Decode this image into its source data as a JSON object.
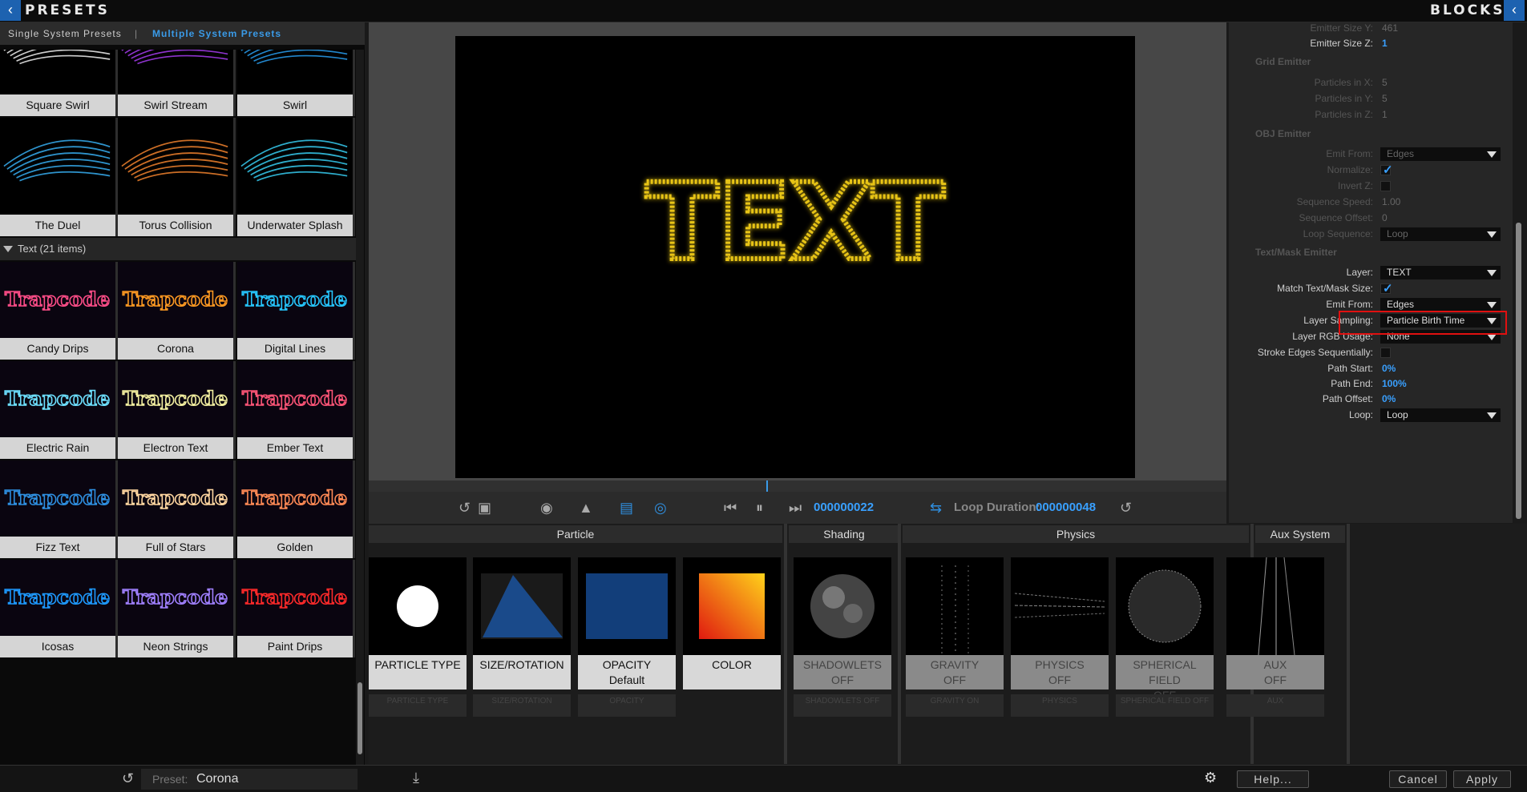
{
  "header": {
    "left_title": "PRESETS",
    "right_title": "BLOCKS",
    "left_btn": "‹",
    "right_btn": "‹"
  },
  "subtabs": {
    "single": "Single System Presets",
    "multiple": "Multiple System Presets",
    "sep": "|"
  },
  "presets_top_rows": [
    [
      "Square Swirl",
      "Swirl Stream",
      "Swirl"
    ],
    [
      "The Duel",
      "Torus Collision",
      "Underwater Splash"
    ]
  ],
  "text_section": {
    "label": "Text (21 items)"
  },
  "text_rows": [
    [
      "Candy Drips",
      "Corona",
      "Digital Lines"
    ],
    [
      "Electric Rain",
      "Electron Text",
      "Ember Text"
    ],
    [
      "Fizz Text",
      "Full of Stars",
      "Golden"
    ],
    [
      "Icosas",
      "Neon Strings",
      "Paint Drips"
    ]
  ],
  "thumb_word": "Trapcode",
  "canvas_text": "TEXT",
  "transport": {
    "frame": "000000022",
    "loop_label": "Loop Duration:",
    "loop_value": "000000048"
  },
  "blocks_panel": {
    "rows": [
      {
        "label": "Emitter Size Y:",
        "value": "461",
        "dim": true,
        "type": "text"
      },
      {
        "label": "Emitter Size Z:",
        "value": "1",
        "dim": false,
        "type": "blue"
      },
      {
        "section": "Grid Emitter"
      },
      {
        "label": "Particles in X:",
        "value": "5",
        "dim": true,
        "type": "text"
      },
      {
        "label": "Particles in Y:",
        "value": "5",
        "dim": true,
        "type": "text"
      },
      {
        "label": "Particles in Z:",
        "value": "1",
        "dim": true,
        "type": "text"
      },
      {
        "section": "OBJ Emitter"
      },
      {
        "label": "Emit From:",
        "value": "Edges",
        "dim": true,
        "type": "dd"
      },
      {
        "label": "Normalize:",
        "value": "",
        "dim": true,
        "type": "check_on"
      },
      {
        "label": "Invert Z:",
        "value": "",
        "dim": true,
        "type": "check_off"
      },
      {
        "label": "Sequence Speed:",
        "value": "1.00",
        "dim": true,
        "type": "text"
      },
      {
        "label": "Sequence Offset:",
        "value": "0",
        "dim": true,
        "type": "text"
      },
      {
        "label": "Loop Sequence:",
        "value": "Loop",
        "dim": true,
        "type": "dd"
      },
      {
        "section": "Text/Mask Emitter"
      },
      {
        "label": "Layer:",
        "value": "TEXT",
        "dim": false,
        "type": "dd"
      },
      {
        "label": "Match Text/Mask Size:",
        "value": "",
        "dim": false,
        "type": "check_on"
      },
      {
        "label": "Emit From:",
        "value": "Edges",
        "dim": false,
        "type": "dd"
      },
      {
        "label": "Layer Sampling:",
        "value": "Particle Birth Time",
        "dim": false,
        "type": "dd"
      },
      {
        "label": "Layer RGB Usage:",
        "value": "None",
        "dim": false,
        "type": "dd"
      },
      {
        "label": "Stroke Edges Sequentially:",
        "value": "",
        "dim": false,
        "type": "check_off"
      },
      {
        "label": "Path Start:",
        "value": "0%",
        "dim": false,
        "type": "blue"
      },
      {
        "label": "Path End:",
        "value": "100%",
        "dim": false,
        "type": "blue"
      },
      {
        "label": "Path Offset:",
        "value": "0%",
        "dim": false,
        "type": "blue"
      },
      {
        "label": "Loop:",
        "value": "Loop",
        "dim": false,
        "type": "dd"
      }
    ]
  },
  "designer": {
    "groups": [
      "Particle",
      "Shading",
      "Physics",
      "Aux System"
    ],
    "blocks": [
      {
        "name": "PARTICLE TYPE",
        "sub": "",
        "small": "PARTICLE TYPE",
        "off": false
      },
      {
        "name": "SIZE/ROTATION",
        "sub": "",
        "small": "SIZE/ROTATION",
        "off": false
      },
      {
        "name": "OPACITY",
        "sub": "Default",
        "small": "OPACITY",
        "off": false
      },
      {
        "name": "COLOR",
        "sub": "",
        "small": "",
        "off": false
      },
      {
        "name": "SHADOWLETS",
        "sub": "OFF",
        "small": "SHADOWLETS OFF",
        "off": true
      },
      {
        "name": "GRAVITY",
        "sub": "OFF",
        "small": "GRAVITY ON",
        "off": true
      },
      {
        "name": "PHYSICS",
        "sub": "OFF",
        "small": "PHYSICS",
        "off": true
      },
      {
        "name": "SPHERICAL FIELD",
        "sub": "OFF",
        "small": "SPHERICAL FIELD OFF",
        "off": true
      },
      {
        "name": "AUX",
        "sub": "OFF",
        "small": "AUX",
        "off": true
      }
    ]
  },
  "bottom": {
    "preset_label": "Preset:",
    "preset_value": "Corona",
    "help": "Help...",
    "cancel": "Cancel",
    "apply": "Apply"
  }
}
